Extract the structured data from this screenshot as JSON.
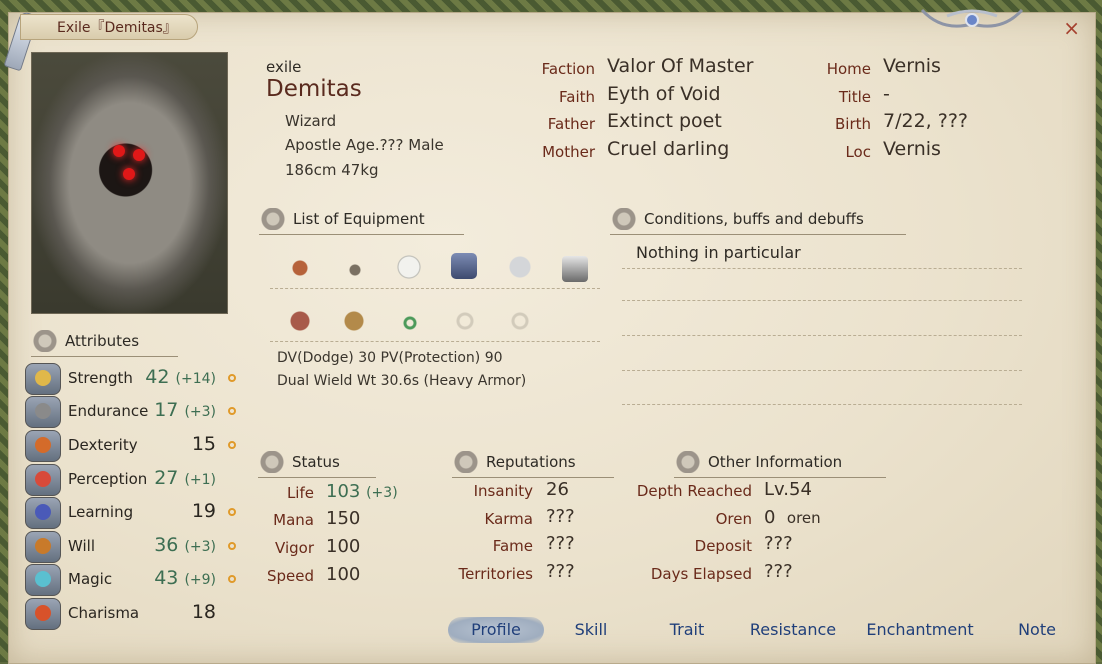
{
  "window": {
    "title": "Exile『Demitas』",
    "close_glyph": "×"
  },
  "profile": {
    "alias": "exile",
    "name": "Demitas",
    "class": "Wizard",
    "age_line": "Apostle Age.??? Male",
    "size_line": "186cm 47kg"
  },
  "family": [
    {
      "label": "Faction",
      "value": "Valor Of Master"
    },
    {
      "label": "Faith",
      "value": "Eyth of Void"
    },
    {
      "label": "Father",
      "value": "Extinct poet"
    },
    {
      "label": "Mother",
      "value": "Cruel darling"
    }
  ],
  "origin": [
    {
      "label": "Home",
      "value": "Vernis"
    },
    {
      "label": "Title",
      "value": "-"
    },
    {
      "label": "Birth",
      "value": "7/22, ???"
    },
    {
      "label": "Loc",
      "value": "Vernis"
    }
  ],
  "equipment": {
    "heading": "List of Equipment",
    "slots_row1": [
      "club-icon",
      "dagger-icon",
      "helmet-icon",
      "armor-icon",
      "wings-icon",
      "gauntlet-icon"
    ],
    "slots_row2": [
      "boots-icon",
      "sandals-icon",
      "amulet-icon",
      "ring-icon",
      "ring-icon"
    ],
    "dv_pv": "DV(Dodge) 30   PV(Protection) 90",
    "wield": "Dual Wield Wt 30.6s (Heavy Armor)"
  },
  "conditions": {
    "heading": "Conditions, buffs and debuffs",
    "text": "Nothing in particular"
  },
  "attributes": {
    "heading": "Attributes",
    "items": [
      {
        "name": "Strength",
        "value": "42",
        "bonus": "(+14)",
        "color": "#e0b84a"
      },
      {
        "name": "Endurance",
        "value": "17",
        "bonus": "(+3)",
        "color": "#8a8a8a"
      },
      {
        "name": "Dexterity",
        "value": "15",
        "bonus": "",
        "color": "#d46b2a"
      },
      {
        "name": "Perception",
        "value": "27",
        "bonus": "(+1)",
        "color": "#d84a3a"
      },
      {
        "name": "Learning",
        "value": "19",
        "bonus": "",
        "color": "#4a5ab8"
      },
      {
        "name": "Will",
        "value": "36",
        "bonus": "(+3)",
        "color": "#c87a2a"
      },
      {
        "name": "Magic",
        "value": "43",
        "bonus": "(+9)",
        "color": "#5ac0d0"
      },
      {
        "name": "Charisma",
        "value": "18",
        "bonus": "",
        "color": "#d8522a"
      }
    ]
  },
  "status": {
    "heading": "Status",
    "items": [
      {
        "label": "Life",
        "value": "103",
        "bonus": "(+3)"
      },
      {
        "label": "Mana",
        "value": "150",
        "bonus": ""
      },
      {
        "label": "Vigor",
        "value": "100",
        "bonus": ""
      },
      {
        "label": "Speed",
        "value": "100",
        "bonus": ""
      }
    ]
  },
  "reputations": {
    "heading": "Reputations",
    "items": [
      {
        "label": "Insanity",
        "value": "26"
      },
      {
        "label": "Karma",
        "value": "???"
      },
      {
        "label": "Fame",
        "value": "???"
      },
      {
        "label": "Territories",
        "value": "???"
      }
    ]
  },
  "other": {
    "heading": "Other Information",
    "items": [
      {
        "label": "Depth Reached",
        "value": "Lv.54"
      },
      {
        "label": "Oren",
        "value": "0",
        "unit": "oren"
      },
      {
        "label": "Deposit",
        "value": "???"
      },
      {
        "label": "Days Elapsed",
        "value": "???"
      }
    ]
  },
  "tabs": [
    "Profile",
    "Skill",
    "Trait",
    "Resistance",
    "Enchantment",
    "Note"
  ],
  "active_tab": "Profile",
  "colors": {
    "accent_label": "#6a2a1a",
    "tab_text": "#203f7a",
    "bonus_green": "#3d6e52",
    "parchment": "#ebe2cd"
  }
}
